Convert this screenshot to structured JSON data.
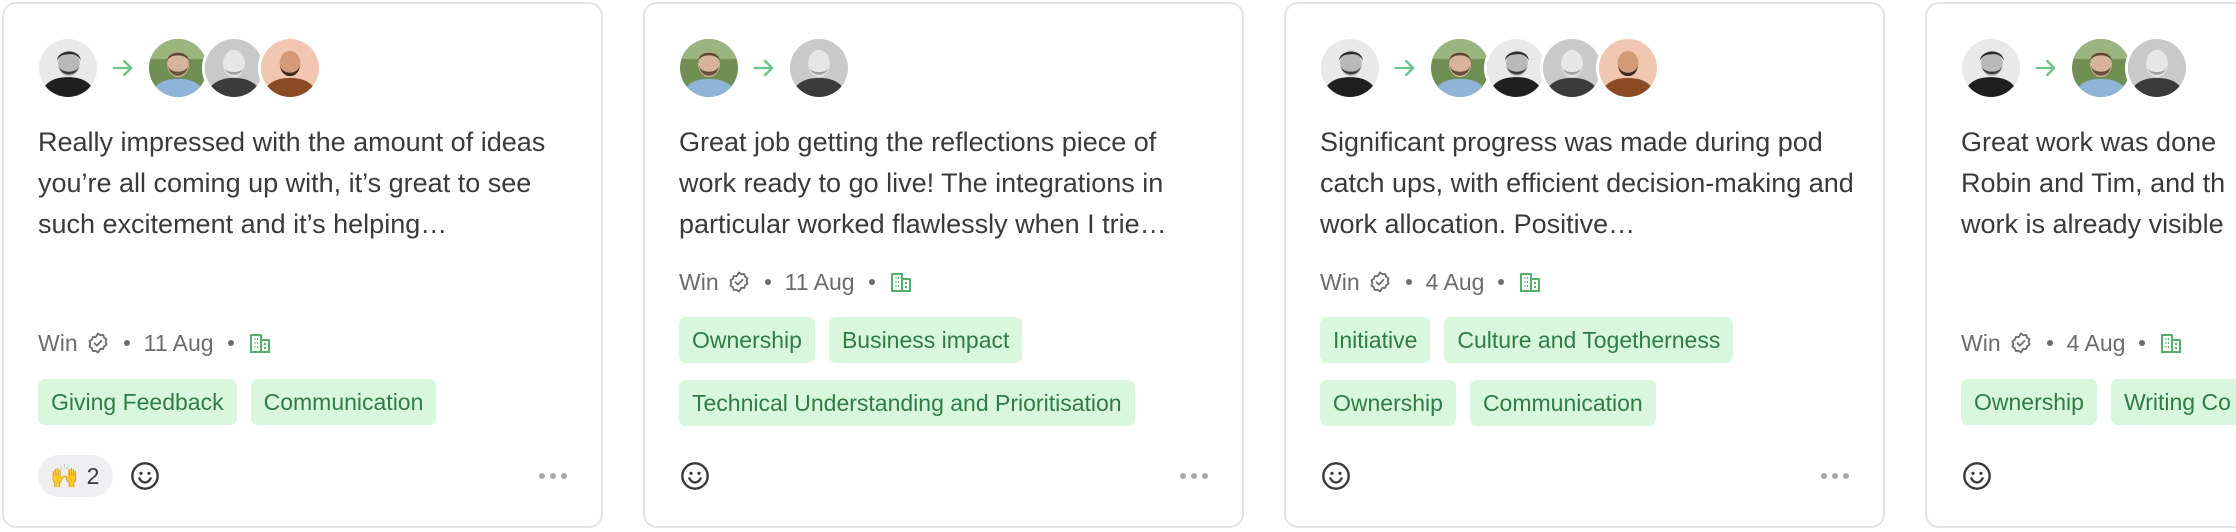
{
  "cards": [
    {
      "text": "Really impressed with the amount of ideas you’re all coming up with, it’s great to see such excitement and it’s helping…",
      "type": "Win",
      "date": "11 Aug",
      "tags": [
        "Giving Feedback",
        "Communication"
      ],
      "reaction": {
        "emoji": "🙌",
        "count": "2"
      }
    },
    {
      "text": "Great job getting the reflections piece of work ready to go live! The integrations in particular worked flawlessly when I trie…",
      "type": "Win",
      "date": "11 Aug",
      "tags": [
        "Ownership",
        "Business impact",
        "Technical Understanding and Prioritisation"
      ]
    },
    {
      "text": "Significant progress was made during pod catch ups, with efficient decision-making and work allocation. Positive…",
      "type": "Win",
      "date": "4 Aug",
      "tags": [
        "Initiative",
        "Culture and Togetherness",
        "Ownership",
        "Communication"
      ]
    },
    {
      "text": "Great work was done Robin and Tim, and th work is already visible",
      "type": "Win",
      "date": "4 Aug",
      "tags": [
        "Ownership",
        "Writing Co"
      ]
    }
  ],
  "icons": {
    "arrow": "arrow-right-icon",
    "verified": "verified-badge-icon",
    "company": "building-icon",
    "add_reaction": "smiley-icon",
    "more": "more-horizontal-icon"
  },
  "colors": {
    "tag_bg": "#d9f7dc",
    "tag_text": "#2e7d44",
    "arrow": "#6cc486",
    "border": "#e4e4e6"
  }
}
